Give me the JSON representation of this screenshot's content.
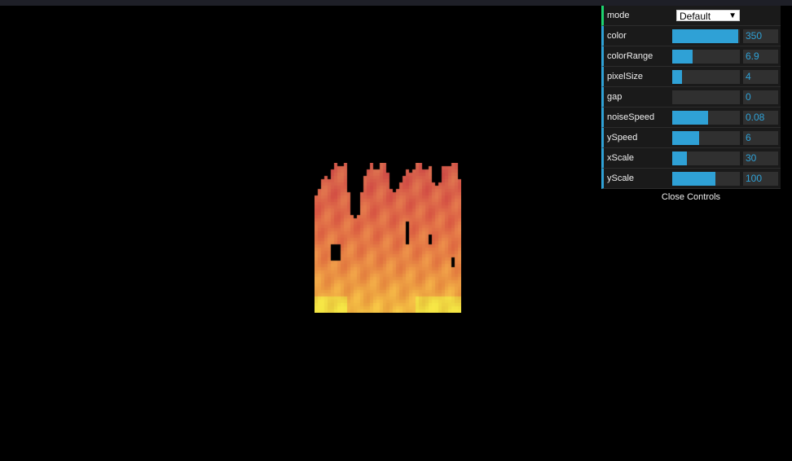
{
  "gui": {
    "mode": {
      "label": "mode",
      "value": "Default"
    },
    "controls": [
      {
        "label": "color",
        "value": "350",
        "fraction": 0.97
      },
      {
        "label": "colorRange",
        "value": "6.9",
        "fraction": 0.3
      },
      {
        "label": "pixelSize",
        "value": "4",
        "fraction": 0.14
      },
      {
        "label": "gap",
        "value": "0",
        "fraction": 0.0
      },
      {
        "label": "noiseSpeed",
        "value": "0.08",
        "fraction": 0.53
      },
      {
        "label": "ySpeed",
        "value": "6",
        "fraction": 0.4
      },
      {
        "label": "xScale",
        "value": "30",
        "fraction": 0.22
      },
      {
        "label": "yScale",
        "value": "100",
        "fraction": 0.64
      }
    ],
    "close_label": "Close Controls"
  },
  "colors": {
    "accent": "#2fa1d6",
    "mode_accent": "#1ed36f",
    "background": "#000000"
  },
  "icons": {
    "select_arrow": "chevron-down-icon"
  }
}
